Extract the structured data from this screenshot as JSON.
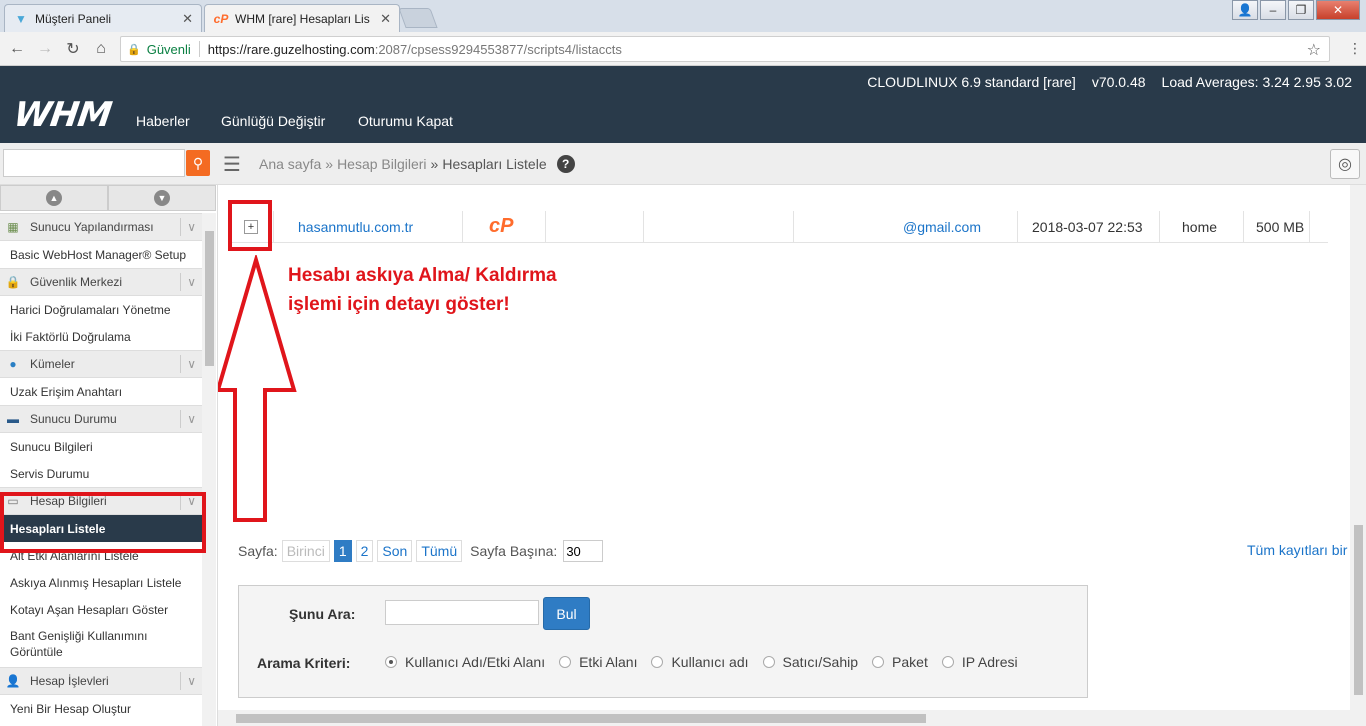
{
  "browser": {
    "tabs": [
      {
        "title": "Müşteri Paneli",
        "icon": "musteri-favicon"
      },
      {
        "title": "WHM [rare] Hesapları Lis",
        "icon": "cpanel-favicon"
      }
    ],
    "secure_label": "Güvenli",
    "url_host": "https://rare.guzelhosting.com",
    "url_rest": ":2087/cpsess9294553877/scripts4/listaccts"
  },
  "header": {
    "logo": "WHM",
    "nav": [
      "Haberler",
      "Günlüğü Değiştir",
      "Oturumu Kapat"
    ],
    "server": "CLOUDLINUX 6.9 standard [rare]",
    "version": "v70.0.48",
    "load": "Load Averages: 3.24 2.95 3.02"
  },
  "breadcrumb": {
    "home": "Ana sayfa",
    "sep": "»",
    "section": "Hesap Bilgileri",
    "current": "Hesapları Listele"
  },
  "sidebar": {
    "items": [
      {
        "type": "cat",
        "label": "Sunucu Yapılandırması",
        "icon": "server-config-icon"
      },
      {
        "type": "item",
        "label": "Basic WebHost Manager® Setup"
      },
      {
        "type": "cat",
        "label": "Güvenlik Merkezi",
        "icon": "lock-icon"
      },
      {
        "type": "item",
        "label": "Harici Doğrulamaları Yönetme"
      },
      {
        "type": "item",
        "label": "İki Faktörlü Doğrulama"
      },
      {
        "type": "cat",
        "label": "Kümeler",
        "icon": "cluster-icon"
      },
      {
        "type": "item",
        "label": "Uzak Erişim Anahtarı"
      },
      {
        "type": "cat",
        "label": "Sunucu Durumu",
        "icon": "server-status-icon"
      },
      {
        "type": "item",
        "label": "Sunucu Bilgileri"
      },
      {
        "type": "item",
        "label": "Servis Durumu"
      },
      {
        "type": "cat",
        "label": "Hesap Bilgileri",
        "icon": "account-info-icon"
      },
      {
        "type": "item",
        "label": "Hesapları Listele",
        "active": true
      },
      {
        "type": "item",
        "label": "Alt Etki Alanlarını Listele"
      },
      {
        "type": "item",
        "label": "Askıya Alınmış Hesapları Listele"
      },
      {
        "type": "item",
        "label": "Kotayı Aşan Hesapları Göster"
      },
      {
        "type": "item",
        "label": "Bant Genişliği Kullanımını Görüntüle",
        "two_line": true
      },
      {
        "type": "cat",
        "label": "Hesap İşlevleri",
        "icon": "account-functions-icon"
      },
      {
        "type": "item",
        "label": "Yeni Bir Hesap Oluştur"
      }
    ]
  },
  "account": {
    "expand": "+",
    "domain": "hasanmutlu.com.tr",
    "email": "@gmail.com",
    "date": "2018-03-07 22:53",
    "partition": "home",
    "quota": "500 MB"
  },
  "annotation": {
    "line1": "Hesabı askıya Alma/ Kaldırma",
    "line2": "işlemi için detayı göster!"
  },
  "pagination": {
    "label": "Sayfa:",
    "first": "Birinci",
    "pages": [
      "1",
      "2"
    ],
    "current_page": "1",
    "last": "Son",
    "all": "Tümü",
    "per_page_label": "Sayfa Başına:",
    "per_page_value": "30",
    "all_records": "Tüm kayıtları bir"
  },
  "search": {
    "label": "Şunu Ara:",
    "value": "",
    "button": "Bul",
    "criteria_label": "Arama Kriteri:",
    "criteria": [
      "Kullanıcı Adı/Etki Alanı",
      "Etki Alanı",
      "Kullanıcı adı",
      "Satıcı/Sahip",
      "Paket",
      "IP Adresi"
    ],
    "selected": "Kullanıcı Adı/Etki Alanı"
  },
  "colors": {
    "header_bg": "#293a4a",
    "accent_orange": "#f46b22",
    "link_blue": "#1b74c9",
    "annotation_red": "#e0151b"
  }
}
